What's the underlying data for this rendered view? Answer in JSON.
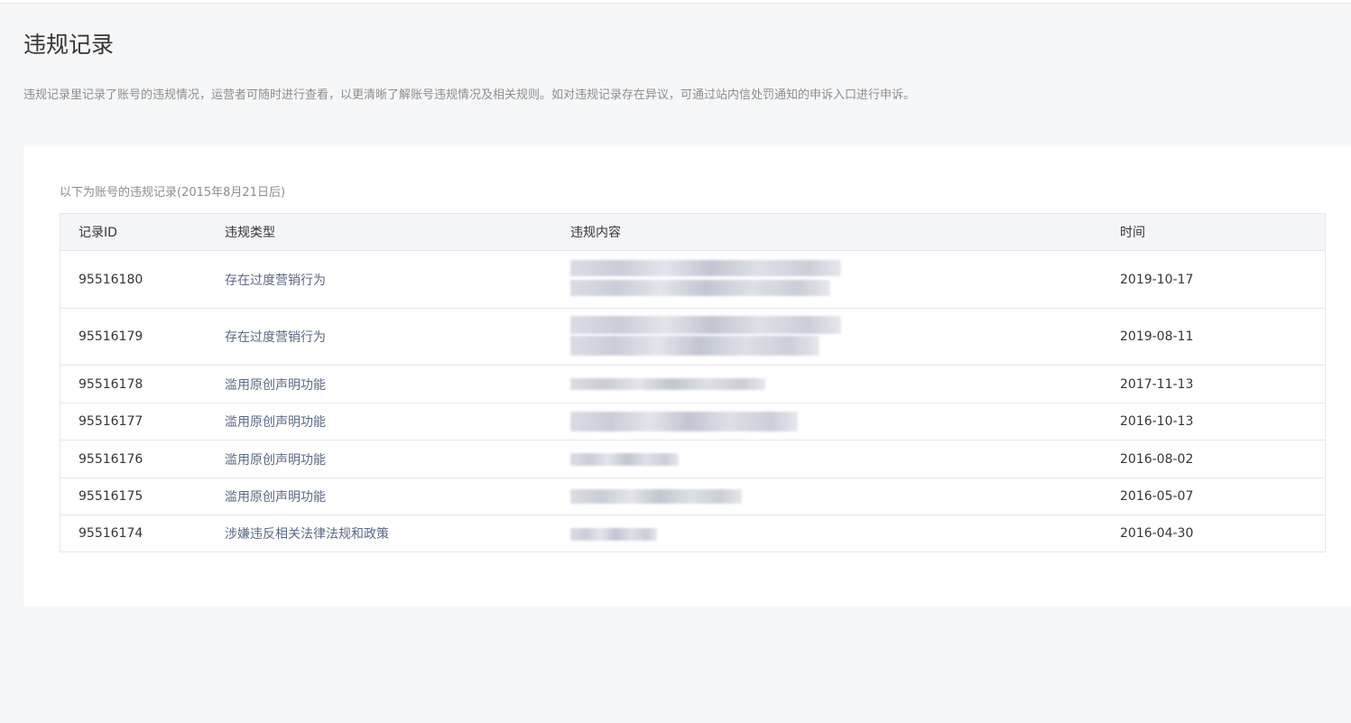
{
  "page": {
    "title": "违规记录",
    "description": "违规记录里记录了账号的违规情况，运营者可随时进行查看，以更清晰了解账号违规情况及相关规则。如对违规记录存在异议，可通过站内信处罚通知的申诉入口进行申诉。"
  },
  "records": {
    "caption": "以下为账号的违规记录(2015年8月21日后)",
    "headers": {
      "id": "记录ID",
      "type": "违规类型",
      "content": "违规内容",
      "time": "时间"
    },
    "rows": [
      {
        "id": "95516180",
        "type": "存在过度营销行为",
        "time": "2019-10-17"
      },
      {
        "id": "95516179",
        "type": "存在过度营销行为",
        "time": "2019-08-11"
      },
      {
        "id": "95516178",
        "type": "滥用原创声明功能",
        "time": "2017-11-13"
      },
      {
        "id": "95516177",
        "type": "滥用原创声明功能",
        "time": "2016-10-13"
      },
      {
        "id": "95516176",
        "type": "滥用原创声明功能",
        "time": "2016-08-02"
      },
      {
        "id": "95516175",
        "type": "滥用原创声明功能",
        "time": "2016-05-07"
      },
      {
        "id": "95516174",
        "type": "涉嫌违反相关法律法规和政策",
        "time": "2016-04-30"
      }
    ]
  }
}
